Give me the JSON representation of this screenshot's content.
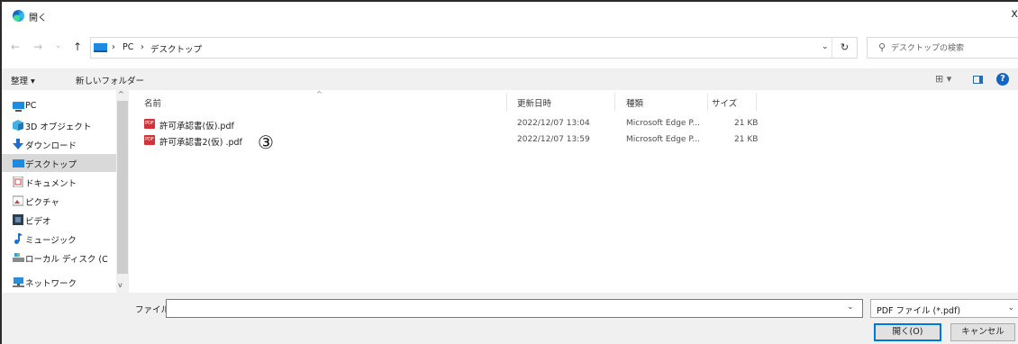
{
  "window": {
    "title": "開く",
    "close_glyph": "x"
  },
  "address": {
    "back": "←",
    "forward": "→",
    "recent": "⌄",
    "up": "↑",
    "crumbs": [
      "PC",
      "デスクトップ"
    ],
    "separator": "›",
    "dropdown": "⌄",
    "refresh": "↻"
  },
  "search": {
    "placeholder": "デスクトップの検索"
  },
  "toolbar": {
    "organize": "整理 ▾",
    "new_folder": "新しいフォルダー",
    "view": "⊞ ▾",
    "help": "?"
  },
  "nav": {
    "items": [
      {
        "label": "PC",
        "icon": "pc-icon"
      },
      {
        "label": "3D オブジェクト",
        "icon": "3d-objects-icon"
      },
      {
        "label": "ダウンロード",
        "icon": "download-icon"
      },
      {
        "label": "デスクトップ",
        "icon": "desktop-icon",
        "selected": true
      },
      {
        "label": "ドキュメント",
        "icon": "documents-icon"
      },
      {
        "label": "ピクチャ",
        "icon": "pictures-icon"
      },
      {
        "label": "ビデオ",
        "icon": "videos-icon"
      },
      {
        "label": "ミュージック",
        "icon": "music-icon"
      },
      {
        "label": "ローカル ディスク (C",
        "icon": "local-disk-icon"
      },
      {
        "label": "ネットワーク",
        "icon": "network-icon"
      }
    ],
    "scroll_up": "^",
    "scroll_down": "v"
  },
  "columns": {
    "name": "名前",
    "modified": "更新日時",
    "type": "種類",
    "size": "サイズ",
    "sort_indicator": "^"
  },
  "files": [
    {
      "name": "許可承認書(仮).pdf",
      "modified": "2022/12/07 13:04",
      "type": "Microsoft Edge P...",
      "size": "21 KB",
      "icon_text": "PDF"
    },
    {
      "name": "許可承認書2(仮) .pdf",
      "modified": "2022/12/07 13:59",
      "type": "Microsoft Edge P...",
      "size": "21 KB",
      "icon_text": "PDF"
    }
  ],
  "annotation": "③",
  "bottom": {
    "filename_label": "ファイル名(N):",
    "filename_value": "",
    "dropdown": "⌄",
    "filetype": "PDF ファイル (*.pdf)",
    "open_button": "開く(O)",
    "cancel_button": "キャンセル"
  }
}
